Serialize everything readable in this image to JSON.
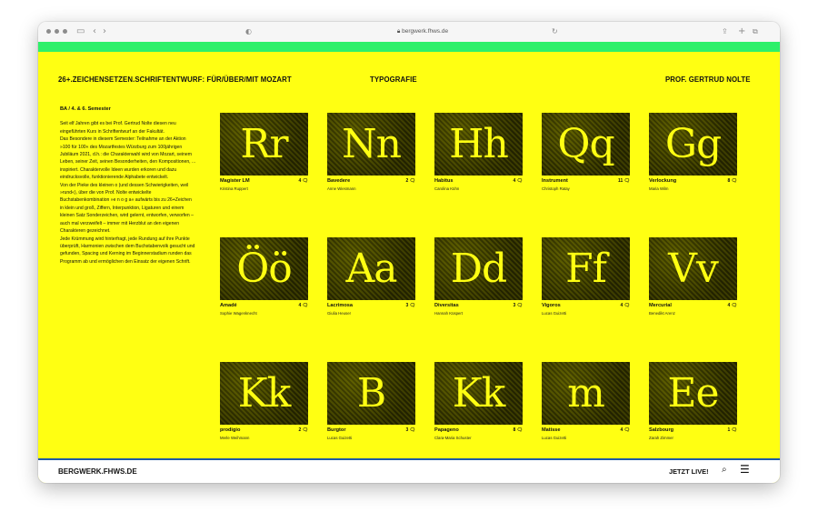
{
  "browser": {
    "url": "bergwerk.fhws.de",
    "reader_icon": "◐",
    "reload_icon": "↻"
  },
  "header": {
    "course": "26+.ZEICHENSETZEN.SCHRIFTENTWURF: FÜR/ÜBER/MIT MOZART",
    "category": "TYPOGRAFIE",
    "professor": "PROF. GERTRUD NOLTE"
  },
  "intro": {
    "semester": "BA / 4. & 6. Semester",
    "paragraphs": [
      "Seit elf Jahren gibt es bei Prof. Gertrud Nolte diesen neu eingeführten Kurs in Schriftentwurf an der Fakultät.",
      "Das Besondere in diesem Semester: Teilnahme an der Aktion »100 für 100« des Mozartfestes Würzburg zum 100jährigen Jubiläum 2021, d.h.: die Charakterwahl wird von Mozart, seinem Leben, seiner Zeit, seinen Besonderheiten, den Kompositionen, ... inspiriert. Charaktervolle Ideen wurden erkoren und dazu eindrucksvolle, funktionierende Alphabete entwickelt.",
      "Von der Pieke des kleinen o (und dessen Schwierigkeiten, weil »rund«), über die von Prof. Nolte entwickelte Buchstabenkombination »e n o g a« aufwärts bis zu 26+Zeichen in klein und groß, Ziffern, Interpunktion, Ligaturen und einem kleinen Satz Sonderzeichen, wird gelernt, entworfen, verworfen – auch mal verzweifelt – immer mit Herzblut an den eigenen Charakteren gezeichnet.",
      "Jede Krümmung wird hinterfragt, jede Rundung auf ihre Punkte überprüft, Harmonien zwischen dem Buchstabenvolk gesucht und gefunden, Spacing und Kerning im Beginnerstadium runden das Programm ab und ermöglichen den Einsatz der eigenen Schrift."
    ]
  },
  "projects": [
    {
      "glyphs": "Rr",
      "title": "Magister LM",
      "author": "Kristina Ruppert",
      "comments": "4"
    },
    {
      "glyphs": "Nn",
      "title": "Bavedere",
      "author": "Anne Wiesmann",
      "comments": "2"
    },
    {
      "glyphs": "Hh",
      "title": "Habitus",
      "author": "Carolina Kühn",
      "comments": "4"
    },
    {
      "glyphs": "Qq",
      "title": "Instrument",
      "author": "Christoph Ratay",
      "comments": "11"
    },
    {
      "glyphs": "Gg",
      "title": "Verlockung",
      "author": "Maria Wilm",
      "comments": "8"
    },
    {
      "glyphs": "Öö",
      "title": "Amadé",
      "author": "Sophie Wagenknecht",
      "comments": "4"
    },
    {
      "glyphs": "Aa",
      "title": "Lacrimosa",
      "author": "Giulia Heuser",
      "comments": "3"
    },
    {
      "glyphs": "Dd",
      "title": "Diversitas",
      "author": "Hannah Küspert",
      "comments": "3"
    },
    {
      "glyphs": "Ff",
      "title": "Vigoros",
      "author": "Lucas Guizetti",
      "comments": "4"
    },
    {
      "glyphs": "Vv",
      "title": "Mercurial",
      "author": "Benedikt Arenz",
      "comments": "4"
    },
    {
      "glyphs": "Kk",
      "title": "prodigio",
      "author": "Merle Weihmann",
      "comments": "2"
    },
    {
      "glyphs": "B",
      "title": "Burgtor",
      "author": "Lucas Guizetti",
      "comments": "3"
    },
    {
      "glyphs": "Kk",
      "title": "Papageno",
      "author": "Clara-Maria Schuster",
      "comments": "8"
    },
    {
      "glyphs": "m",
      "title": "Matisse",
      "author": "Lucas Guizetti",
      "comments": "4"
    },
    {
      "glyphs": "Ee",
      "title": "Salzbourg",
      "author": "Zarah Zimmer",
      "comments": "1"
    }
  ],
  "footer": {
    "logo": "BERGWERK.FHWS.DE",
    "live": "JETZT LIVE!"
  },
  "colors": {
    "accent": "#ffff12",
    "green": "#2ef06a",
    "tile": "#151500",
    "footer_line": "#1f5aa6"
  }
}
